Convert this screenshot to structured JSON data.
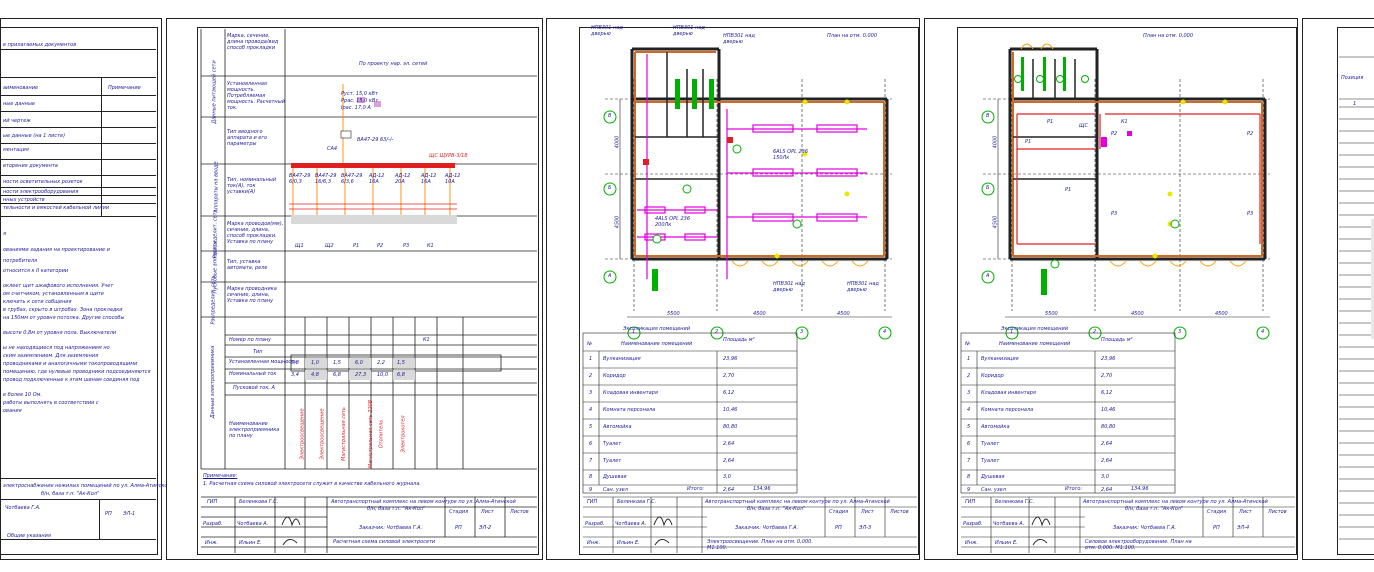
{
  "sheet1": {
    "lines": [
      "е прилагаемых документов",
      "аименование",
      "Примечание",
      "ные данные",
      "ий чертеж",
      "ые данные (на 1 листе)",
      "ментация",
      "вторения документа",
      "ности осветительных розеток",
      "ности электрооборудования",
      "нных устройств",
      "тельности и емкостей кабельной линии"
    ],
    "notes": [
      "я",
      "ованиями задания на проектирование и",
      "потребителя",
      "относится к II категории",
      "оклеет щит шкафового исполнения. Учет",
      "ом счетчиком, установленным в щите",
      "ключить к сети собщения",
      "в трубах, скрыто в штробах. Зона прокладки",
      "на 150мм от уровня потолка. Другие способы",
      "высоте 0,8м от уровня пола. Выключатели",
      "ы не находящиеся под напряжением но",
      "ским заземлением. Для заземления",
      "проводниками и аналогичными токопроводящими",
      "помещению, где нулевые проводники подсоединяются",
      "провод подключенные к этим шинам соединяя под",
      "е более 10 Ом.",
      "работы выполнять в соответствии с",
      "ования"
    ],
    "stamp_line1": "электроснабжение нежилых помещений по ул. Алма-Атинской",
    "stamp_line2": "б/н, база т.п. \"Ак-Кол\"",
    "author": "Чотбаева Г.А.",
    "stage": "РП",
    "sheet": "ЭЛ-1",
    "title": "Общие указания"
  },
  "sheet2": {
    "rows": [
      "Марка, сечение, длина провода/вид способ прокладки",
      "Установленная мощность. Потребляемая мощность. Расчетный ток.",
      "Тип вводного аппарата и его параметры",
      "Тип, номинальный ток(А), ток уставки(А)",
      "Марка проводов(мм), сечение, длина, способ прокладки. Уставка по плану",
      "Тип, уставка автомата, реле",
      "Марка проводника сечение, длина, Уставка по плану"
    ],
    "feed": "По проекту нар. эл. сетей",
    "power": [
      "Руст. 15,0 кВт",
      "Ррас. 15,0 кВт",
      "Iрас. 17,0 А"
    ],
    "breaker": "ВА47-29 63/-/-",
    "ca4": "СА4",
    "shield": "ЩС ЩУРВ-3/18",
    "group_labels": [
      "ВА47-29 6/0,3",
      "ВА47-29 16/6,3",
      "ВА47-29 6/3,6",
      "АД-12 16А",
      "АД-12 20А",
      "АД-12 16А",
      "АД-12 10А"
    ],
    "group_codes": [
      "Щ1",
      "Щ2",
      "Р1",
      "Р2",
      "Р3",
      "К1"
    ],
    "vert_labels": [
      "Данные питающей сети",
      "Аппараты на вводе",
      "Распределит. сеть",
      "Пусковые аппараты",
      "Распределит. сеть",
      "Данные электроприемника"
    ],
    "plan_no_label": "Номер по плану",
    "plan_no_value": "К1",
    "type_label": "Тип",
    "power_label": "Установленная мощность",
    "current_label": "Номинальный ток",
    "pusk_label": "Пусковой ток, А",
    "name_label": "Наименование электроприемника по плану",
    "powers": [
      "0,8",
      "1,0",
      "1,5",
      "6,0",
      "2,2",
      "1,5"
    ],
    "currents": [
      "3,4",
      "4,8",
      "6,8",
      "27,3",
      "10,0",
      "6,8"
    ],
    "names": [
      "Электроосвещение",
      "Электроосвещение",
      "Магистральная сеть",
      "Магистральная сеть 220В",
      "Отопитель",
      "Электрокотел"
    ],
    "note_title": "Примечание:",
    "note": "1. Расчетная схема силовой электросети служит в качестве кабельного журнала.",
    "gip_label": "ГИП",
    "gip": "Беленкова Г.С.",
    "razrab_label": "Разраб.",
    "razrab": "Чотбаева А.",
    "ispol_label": "Инж.",
    "ispol": "Ильин Е.",
    "stamp_line1": "Автотранспортный комплекс на левом контуре по ул. Алма-Атинской",
    "stamp_line2": "б/н, база т.п. \"Ак-Кол\"",
    "stadiya_label": "Стадия",
    "list_label": "Лист",
    "listov_label": "Листов",
    "stage": "РП",
    "sheet": "ЭЛ-2",
    "customer": "Заказчик: Чотбаева Г.А.",
    "title": "Расчетная схема силовой электросети"
  },
  "sheet3": {
    "plan_title": "План на отм. 0,000",
    "labels": [
      "НПВ301 над дверью",
      "НПВ301 над дверью",
      "НПВ301 над дверью",
      "НПВ301 над дверью",
      "НПВ301 над дверью"
    ],
    "hall": "6ALS OPL 236 150Лк",
    "room": "4ALS OPL 236 200Лк",
    "axes_h": [
      "1",
      "2",
      "3",
      "4"
    ],
    "axes_v": [
      "В",
      "Б",
      "А"
    ],
    "dims_h": [
      "5500",
      "4500",
      "4500"
    ],
    "dims_v": [
      "4000",
      "4500"
    ],
    "explication_title": "Экспликация помещений",
    "headers": [
      "№",
      "Наименование помещений",
      "Площадь м²"
    ],
    "rooms": [
      [
        "1",
        "Вулканизация",
        "23,96"
      ],
      [
        "2",
        "Коридор",
        "2,70"
      ],
      [
        "3",
        "Кладовая инвентаря",
        "6,12"
      ],
      [
        "4",
        "Комната персонала",
        "10,46"
      ],
      [
        "5",
        "Автомойка",
        "80,80"
      ],
      [
        "6",
        "Туалет",
        "2,64"
      ],
      [
        "7",
        "Туалет",
        "2,64"
      ],
      [
        "8",
        "Душевая",
        "3,0"
      ],
      [
        "9",
        "Сан. узел",
        "2,64"
      ]
    ],
    "total_label": "Итого:",
    "total": "134,96",
    "gip_label": "ГИП",
    "gip": "Беленкова Г.С.",
    "razrab_label": "Разраб.",
    "razrab": "Чотбаева А.",
    "ispol_label": "Инж.",
    "ispol": "Ильин Е.",
    "stamp_line1": "Автотранспортный комплекс на левом контуре по ул. Алма-Атинской",
    "stamp_line2": "б/н, база т.п. \"Ак-Кол\"",
    "stadiya_label": "Стадия",
    "list_label": "Лист",
    "listov_label": "Листов",
    "stage": "РП",
    "sheet": "ЭЛ-3",
    "customer": "Заказчик: Чотбаева Г.А.",
    "title": "Электроосвещение. План на отм. 0,000. М1:100."
  },
  "sheet4": {
    "plan_title": "План на отм. 0,000",
    "shield": "ЩС",
    "groups": [
      "Р1",
      "Р1",
      "Р1",
      "Р2",
      "Р2",
      "Р3",
      "Р3",
      "К1"
    ],
    "axes_h": [
      "1",
      "2",
      "3",
      "4"
    ],
    "axes_v": [
      "В",
      "Б",
      "А"
    ],
    "dims_h": [
      "5500",
      "4500",
      "4500"
    ],
    "dims_v": [
      "4000",
      "4500"
    ],
    "explication_title": "Экспликация помещений",
    "headers": [
      "№",
      "Наименование помещений",
      "Площадь м²"
    ],
    "rooms": [
      [
        "1",
        "Вулканизация",
        "23,96"
      ],
      [
        "2",
        "Коридор",
        "2,70"
      ],
      [
        "3",
        "Кладовая инвентаря",
        "6,12"
      ],
      [
        "4",
        "Комната персонала",
        "10,46"
      ],
      [
        "5",
        "Автомойка",
        "80,80"
      ],
      [
        "6",
        "Туалет",
        "2,64"
      ],
      [
        "7",
        "Туалет",
        "2,64"
      ],
      [
        "8",
        "Душевая",
        "3,0"
      ],
      [
        "9",
        "Сан. узел",
        "2,64"
      ]
    ],
    "total_label": "Итого:",
    "total": "134,96",
    "gip_label": "ГИП",
    "gip": "Беленкова Г.С.",
    "razrab_label": "Разраб.",
    "razrab": "Чотбаева А.",
    "ispol_label": "Инж.",
    "ispol": "Ильин Е.",
    "stamp_line1": "Автотранспортный комплекс на левом контуре по ул. Алма-Атинской",
    "stamp_line2": "б/н, база т.п. \"Ак-Кол\"",
    "stadiya_label": "Стадия",
    "list_label": "Лист",
    "listov_label": "Листов",
    "stage": "РП",
    "sheet": "ЭЛ-4",
    "customer": "Заказчик: Чотбаева Г.А.",
    "title": "Силовое электрооборудование. План на отм. 0,000. М1:100."
  },
  "sheet5": {
    "header": "Позиция",
    "row1": "1"
  },
  "colors": {
    "ink": "#1a1a9a",
    "wall": "#d2691e",
    "wall_dark": "#222222",
    "magenta": "#e000e0",
    "green": "#00b000",
    "orange": "#ff9900",
    "red": "#e02020",
    "yellow": "#e8e800"
  }
}
